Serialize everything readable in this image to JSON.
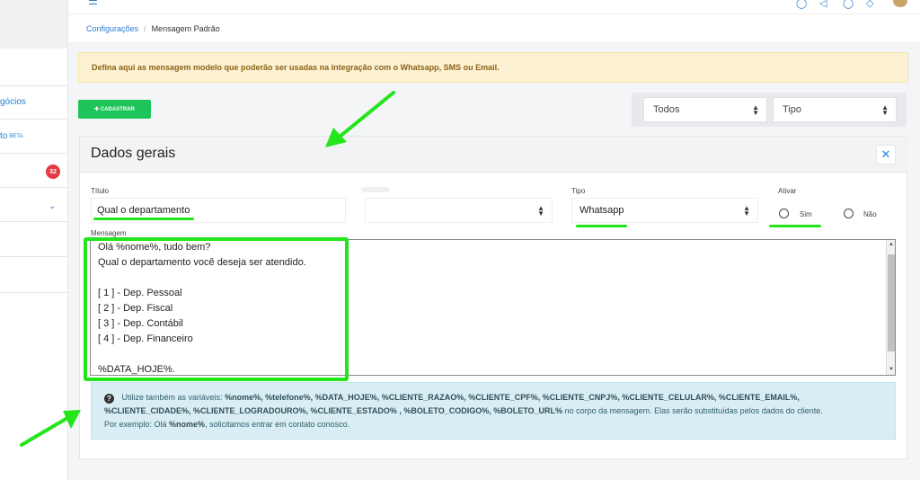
{
  "sidebar": {
    "items": [
      {
        "label": "gócios"
      },
      {
        "label": "to",
        "suffix": "BETA"
      },
      {
        "label": "",
        "badge": "32"
      },
      {
        "label": "",
        "chevron": "⌄"
      }
    ]
  },
  "topbar": {
    "menu_icon": "menu-icon",
    "icons": [
      "help-icon",
      "telegram-icon",
      "whatsapp-icon",
      "layers-icon"
    ]
  },
  "breadcrumb": {
    "parent": "Configurações",
    "separator": "/",
    "current": "Mensagem Padrão"
  },
  "alert": {
    "text": "Defina aqui as mensagem modelo que poderão ser usadas na integração com o Whatsapp, SMS ou Email."
  },
  "toolbar": {
    "register_label": "✚ CADASTRAR",
    "filter_all": "Todos",
    "filter_type": "Tipo"
  },
  "panel": {
    "title": "Dados gerais",
    "close_label": "✕",
    "titulo_label": "Título",
    "titulo_value": "Qual o departamento",
    "blank_select_value": "",
    "tipo_label": "Tipo",
    "tipo_value": "Whatsapp",
    "ativar_label": "Ativar",
    "ativar_yes": "Sim",
    "ativar_no": "Não",
    "mensagem_label": "Mensagem",
    "message_lines": [
      "Olá %nome%, tudo bem?",
      "Qual o departamento você deseja ser atendido.",
      "",
      "[ 1 ] - Dep. Pessoal",
      "[ 2 ] - Dep. Fiscal",
      "[ 3 ] - Dep. Contábil",
      "[ 4 ] - Dep. Financeiro",
      "",
      "%DATA_HOJE%."
    ]
  },
  "info": {
    "prefix": "Utilize também as variáveis:",
    "variables_line1": "%nome%, %telefone%, %DATA_HOJE%, %CLIENTE_RAZAO%, %CLIENTE_CPF%, %CLIENTE_CNPJ%, %CLIENTE_CELULAR%, %CLIENTE_EMAIL%,",
    "variables_line2": "%CLIENTE_CIDADE%, %CLIENTE_LOGRADOURO%, %CLIENTE_ESTADO% , %BOLETO_CODIGO%, %BOLETO_URL%",
    "suffix": "no corpo da mensagem. Elas serão substituídas pelos dados do cliente.",
    "example_prefix": "Por exemplo: Olá",
    "example_var": "%nome%",
    "example_suffix": ", solicitamos entrar em contato conosco."
  },
  "annotation_color": "#22e51a"
}
